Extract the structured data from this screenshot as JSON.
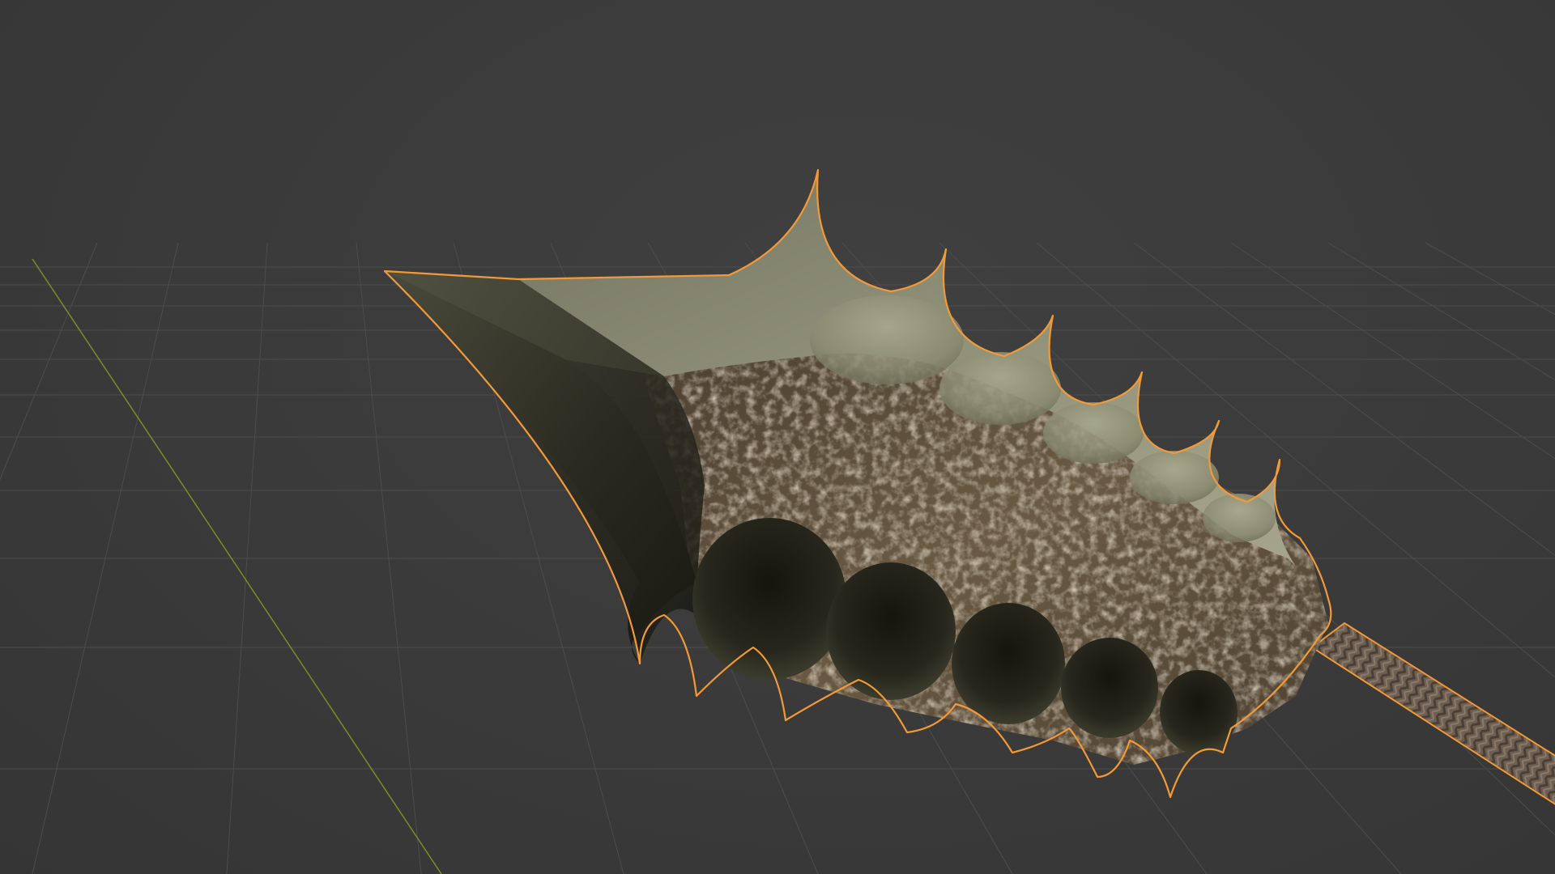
{
  "app": {
    "name": "3D viewport"
  },
  "viewport": {
    "background_color": "#3a3a3a",
    "grid_color": "#4c4c4c",
    "y_axis_color": "#7a8d2a",
    "selection_outline_color": "#f29a38",
    "object": {
      "name_icon": "spear-head-mesh-icon",
      "selected": true,
      "material_colors": {
        "blade_metal_light": "#8f8f78",
        "blade_metal_dark": "#1e1e16",
        "rough_body": "#5a4a36",
        "handle": "#6e5f52"
      }
    }
  }
}
